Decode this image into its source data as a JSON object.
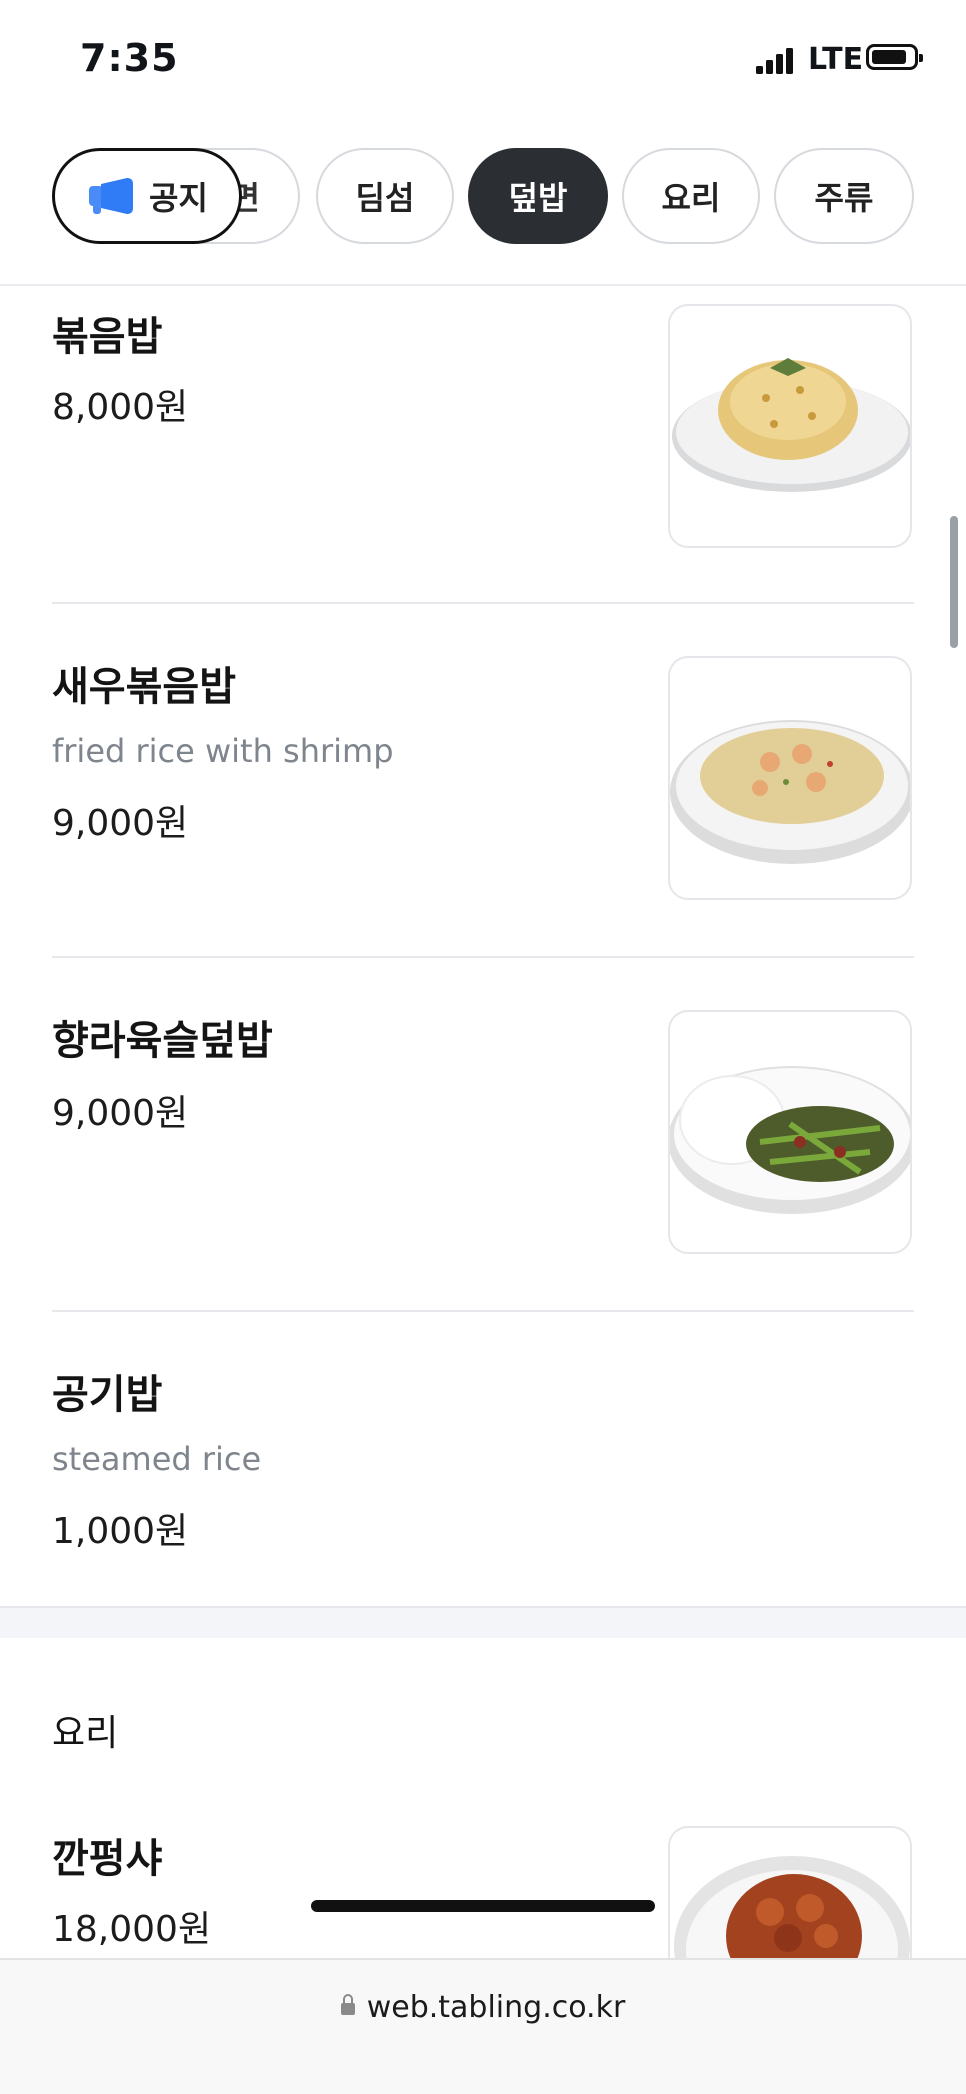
{
  "status_bar": {
    "time": "7:35",
    "network": "LTE"
  },
  "tabs": {
    "notice": "공지",
    "partial": "면",
    "items": [
      "딤섬",
      "덮밥",
      "요리",
      "주류"
    ],
    "active": "덮밥"
  },
  "menu": [
    {
      "name": "볶음밥",
      "desc": "",
      "price": "8,000원",
      "image_icon": "fried-rice-photo"
    },
    {
      "name": "새우볶음밥",
      "desc": "fried rice with shrimp",
      "price": "9,000원",
      "image_icon": "shrimp-fried-rice-photo"
    },
    {
      "name": "향라육슬덮밥",
      "desc": "",
      "price": "9,000원",
      "image_icon": "pork-rice-bowl-photo"
    },
    {
      "name": "공기밥",
      "desc": "steamed rice",
      "price": "1,000원"
    }
  ],
  "section": {
    "title": "요리",
    "items": [
      {
        "name": "깐펑샤",
        "price": "18,000원",
        "image_icon": "shrimp-dish-photo"
      }
    ]
  },
  "browser": {
    "url": "web.tabling.co.kr"
  }
}
